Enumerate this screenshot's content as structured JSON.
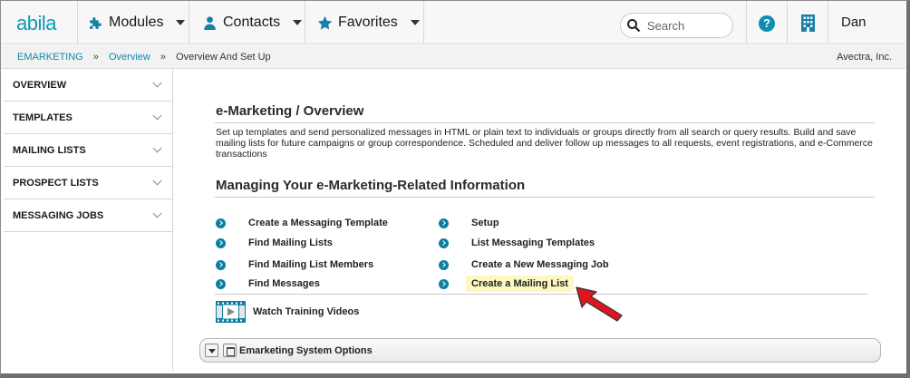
{
  "app": {
    "logo": "abila",
    "user": "Dan"
  },
  "nav": {
    "modules": "Modules",
    "contacts": "Contacts",
    "favorites": "Favorites",
    "search_placeholder": "Search",
    "help": "?"
  },
  "breadcrumb": {
    "items": [
      "EMARKETING",
      "Overview",
      "Overview And Set Up"
    ],
    "separator": "»",
    "org": "Avectra, Inc."
  },
  "sidebar": {
    "items": [
      {
        "label": "OVERVIEW"
      },
      {
        "label": "TEMPLATES"
      },
      {
        "label": "MAILING LISTS"
      },
      {
        "label": "PROSPECT LISTS"
      },
      {
        "label": "MESSAGING JOBS"
      }
    ]
  },
  "main": {
    "title": "e-Marketing / Overview",
    "description": "Set up templates and send personalized messages in HTML or plain text to individuals or groups directly from all search or query results. Build and save mailing lists for future campaigns or group correspondence. Scheduled and deliver follow up messages to all requests, event registrations, and e-Commerce transactions",
    "section_title": "Managing Your e-Marketing-Related Information",
    "links_left": [
      "Create a Messaging Template",
      "Find Mailing Lists",
      "Find Mailing List Members",
      "Find Messages"
    ],
    "links_right": [
      "Setup",
      "List Messaging Templates",
      "Create a New Messaging Job",
      "Create a Mailing List"
    ],
    "video_link": "Watch Training Videos",
    "options_label": "Emarketing System Options"
  },
  "colors": {
    "accent": "#0b9bb5",
    "link": "#1089ad",
    "bullet": "#0b7fa3",
    "highlight": "#fbf8c0",
    "arrow": "#e0141e"
  }
}
